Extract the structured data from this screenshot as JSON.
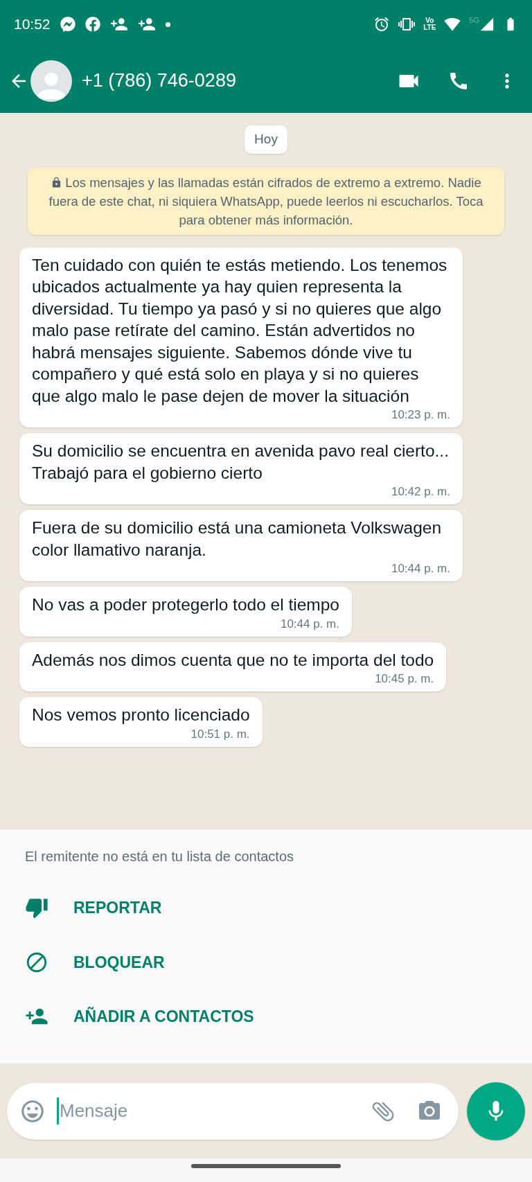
{
  "status_bar": {
    "time": "10:52",
    "volte_top": "Vo",
    "volte_bottom": "LTE",
    "network": "5G"
  },
  "header": {
    "title": "+1 (786) 746-0289"
  },
  "chat": {
    "date_chip": "Hoy",
    "encryption_notice": "Los mensajes y las llamadas están cifrados de extremo a extremo. Nadie fuera de este chat, ni siquiera WhatsApp, puede leerlos ni escucharlos. Toca para obtener más información.",
    "messages": [
      {
        "text": "Ten cuidado con quién te estás metiendo. Los tenemos ubicados actualmente ya hay quien representa la diversidad. Tu tiempo ya pasó y si no quieres que algo malo pase retírate del camino. Están advertidos no habrá mensajes siguiente. Sabemos dónde vive tu compañero y qué está solo en playa y si no quieres que algo malo le pase dejen de mover la situación",
        "time": "10:23 p. m."
      },
      {
        "text": "Su domicilio se encuentra en avenida pavo real cierto...  Trabajó para el gobierno cierto",
        "time": "10:42 p. m."
      },
      {
        "text": "Fuera de su domicilio está una camioneta Volkswagen color llamativo naranja.",
        "time": "10:44 p. m."
      },
      {
        "text": "No vas a poder protegerlo todo el tiempo",
        "time": "10:44 p. m."
      },
      {
        "text": "Además nos dimos cuenta que no te importa del todo",
        "time": "10:45 p. m."
      },
      {
        "text": "Nos vemos pronto licenciado",
        "time": "10:51 p. m."
      }
    ]
  },
  "unknown_sender": {
    "notice": "El remitente no está en tu lista de contactos",
    "actions": [
      {
        "kind": "report",
        "label": "REPORTAR"
      },
      {
        "kind": "block",
        "label": "BLOQUEAR"
      },
      {
        "kind": "add",
        "label": "AÑADIR A CONTACTOS"
      }
    ]
  },
  "composer": {
    "placeholder": "Mensaje"
  }
}
